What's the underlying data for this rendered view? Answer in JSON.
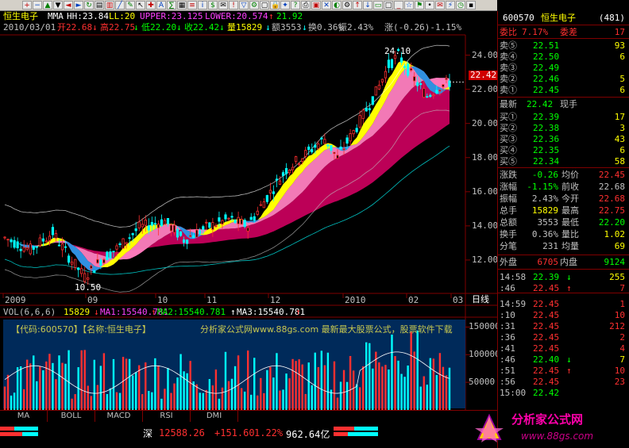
{
  "header": {
    "stock_name": "恒生电子",
    "indicator": "MMA",
    "hh": "HH:23.84",
    "ll": "LL:20",
    "upper": "UPPER:23.125",
    "lower": "LOWER:20.574",
    "lower_val": "21.92",
    "date": "2010/03/01",
    "open": "开22.68",
    "high": "高22.75",
    "low": "低22.20",
    "close": "收22.42",
    "volume": "量15829",
    "amount": "额3553",
    "turnover": "换0.36%",
    "amplitude": "振2.43%",
    "change": "涨(-0.26)-1.15%"
  },
  "chart_labels": {
    "high_mark": "24.10",
    "low_mark": "10.50",
    "current_price": "22.42",
    "y_ticks": [
      "24.00",
      "22.00",
      "20.00",
      "18.00",
      "16.00",
      "14.00",
      "12.00"
    ],
    "x_ticks": [
      "2009",
      "09",
      "10",
      "11",
      "12",
      "2010",
      "02",
      "03"
    ],
    "period": "日线",
    "vol_ticks": [
      "150000",
      "100000",
      "50000"
    ]
  },
  "volume_header": {
    "label": "VOL(6,6,6)",
    "vol": "15829",
    "ma1": "MA1:15540.781",
    "ma2": "MA2:15540.781",
    "ma3": "MA3:15540.781"
  },
  "vol_banner": {
    "code_name": "【代码:600570】【名称:恒生电子】",
    "ad": "分析家公式网www.88gs.com 最新最大股票公式，股票软件下载"
  },
  "tabs": [
    "MA",
    "BOLL",
    "MACD",
    "RSI",
    "DMI"
  ],
  "status": {
    "market": "深",
    "index": "12588.26",
    "change": "+151.60",
    "pct": "1.22%",
    "turnover": "962.64亿"
  },
  "right_panel": {
    "code": "600570",
    "name": "恒生电子",
    "count": "(481)",
    "weibi_label": "委比",
    "weibi_val": "7.17%",
    "weicha_label": "委差",
    "weicha_val": "17",
    "asks": [
      {
        "label": "卖⑤",
        "price": "22.51",
        "vol": "93"
      },
      {
        "label": "卖④",
        "price": "22.50",
        "vol": "6"
      },
      {
        "label": "卖③",
        "price": "22.49",
        "vol": ""
      },
      {
        "label": "卖②",
        "price": "22.46",
        "vol": "5"
      },
      {
        "label": "卖①",
        "price": "22.45",
        "vol": "6"
      }
    ],
    "latest_label": "最新",
    "latest_val": "22.42",
    "xianshou_label": "现手",
    "bids": [
      {
        "label": "买①",
        "price": "22.39",
        "vol": "17"
      },
      {
        "label": "买②",
        "price": "22.38",
        "vol": "3"
      },
      {
        "label": "买③",
        "price": "22.36",
        "vol": "43"
      },
      {
        "label": "买④",
        "price": "22.35",
        "vol": "6"
      },
      {
        "label": "买⑤",
        "price": "22.34",
        "vol": "58"
      }
    ],
    "stats": [
      {
        "l1": "涨跌",
        "v1": "-0.26",
        "l2": "均价",
        "v2": "22.45"
      },
      {
        "l1": "涨幅",
        "v1": "-1.15%",
        "l2": "前收",
        "v2": "22.68"
      },
      {
        "l1": "振幅",
        "v1": "2.43%",
        "l2": "今开",
        "v2": "22.68"
      },
      {
        "l1": "总手",
        "v1": "15829",
        "l2": "最高",
        "v2": "22.75"
      },
      {
        "l1": "总额",
        "v1": "3553",
        "l2": "最低",
        "v2": "22.20"
      },
      {
        "l1": "换手",
        "v1": "0.36%",
        "l2": "量比",
        "v2": "1.02"
      },
      {
        "l1": "分笔",
        "v1": "231",
        "l2": "均量",
        "v2": "69"
      }
    ],
    "waipan_label": "外盘",
    "waipan_val": "6705",
    "neipan_label": "内盘",
    "neipan_val": "9124",
    "ticks": [
      {
        "time": "14:58",
        "price": "22.39",
        "arrow": "↓",
        "vol": "255",
        "up": false
      },
      {
        "time": ":46",
        "price": "22.45",
        "arrow": "↑",
        "vol": "7",
        "up": true
      },
      {
        "time": "14:59",
        "price": "22.45",
        "arrow": "",
        "vol": "1",
        "up": true
      },
      {
        "time": ":10",
        "price": "22.45",
        "arrow": "",
        "vol": "10",
        "up": true
      },
      {
        "time": ":31",
        "price": "22.45",
        "arrow": "",
        "vol": "212",
        "up": true
      },
      {
        "time": ":36",
        "price": "22.45",
        "arrow": "",
        "vol": "2",
        "up": true
      },
      {
        "time": ":41",
        "price": "22.45",
        "arrow": "",
        "vol": "4",
        "up": true
      },
      {
        "time": ":46",
        "price": "22.40",
        "arrow": "↓",
        "vol": "7",
        "up": false
      },
      {
        "time": ":51",
        "price": "22.45",
        "arrow": "↑",
        "vol": "10",
        "up": true
      },
      {
        "time": ":56",
        "price": "22.45",
        "arrow": "",
        "vol": "23",
        "up": true
      },
      {
        "time": "15:00",
        "price": "22.42",
        "arrow": "",
        "vol": "",
        "up": false
      }
    ]
  },
  "watermark": {
    "text": "分析家公式网",
    "url": "www.88gs.com"
  },
  "colors": {
    "up": "#ff3030",
    "down": "#00ffff",
    "yellow": "#ffff00",
    "pink": "#ff80c0",
    "dark_pink": "#d00060",
    "white": "#ffffff",
    "border": "#800000"
  }
}
